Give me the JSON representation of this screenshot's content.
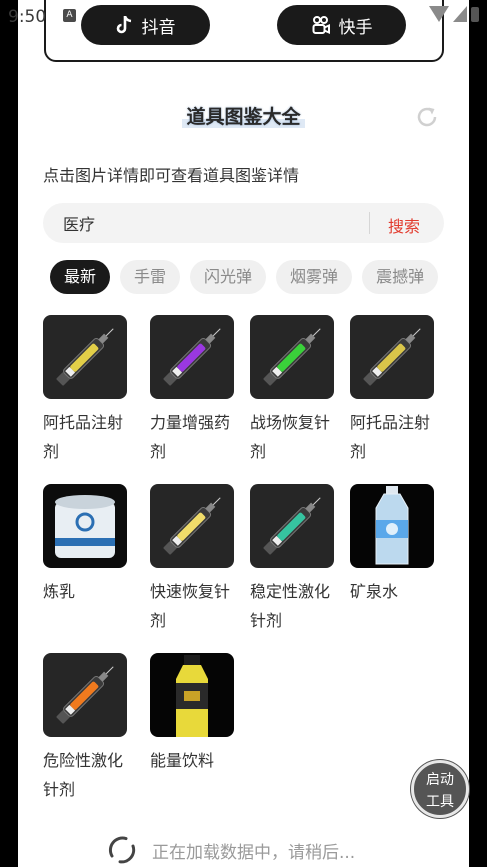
{
  "status_bar": {
    "time": "9:50",
    "notif_letter": "A"
  },
  "apps": {
    "douyin_label": "抖音",
    "kuaishou_label": "快手"
  },
  "title": "道具图鉴大全",
  "hint": "点击图片详情即可查看道具图鉴详情",
  "search": {
    "value": "医疗",
    "button": "搜索"
  },
  "tabs": [
    "最新",
    "手雷",
    "闪光弹",
    "烟雾弹",
    "震撼弹"
  ],
  "items": [
    {
      "name": "阿托品注射剂",
      "kind": "syringe",
      "color": "#e3cf48"
    },
    {
      "name": "力量增强药剂",
      "kind": "syringe",
      "color": "#9a38e0"
    },
    {
      "name": "战场恢复针剂",
      "kind": "syringe",
      "color": "#3ad13a"
    },
    {
      "name": "阿托品注射剂",
      "kind": "syringe",
      "color": "#d9c54a"
    },
    {
      "name": "炼乳",
      "kind": "milk",
      "color": "#2b6fb3"
    },
    {
      "name": "快速恢复针剂",
      "kind": "syringe",
      "color": "#f0dc6a"
    },
    {
      "name": "稳定性激化针剂",
      "kind": "syringe",
      "color": "#36c3a0"
    },
    {
      "name": "矿泉水",
      "kind": "water",
      "color": "#5aa8ea"
    },
    {
      "name": "危险性激化针剂",
      "kind": "syringe",
      "color": "#f07a1e"
    },
    {
      "name": "能量饮料",
      "kind": "drink",
      "color": "#e8d93a"
    }
  ],
  "loading_text": "正在加载数据中，请稍后...",
  "float_button": {
    "line1": "启动",
    "line2": "工具"
  }
}
